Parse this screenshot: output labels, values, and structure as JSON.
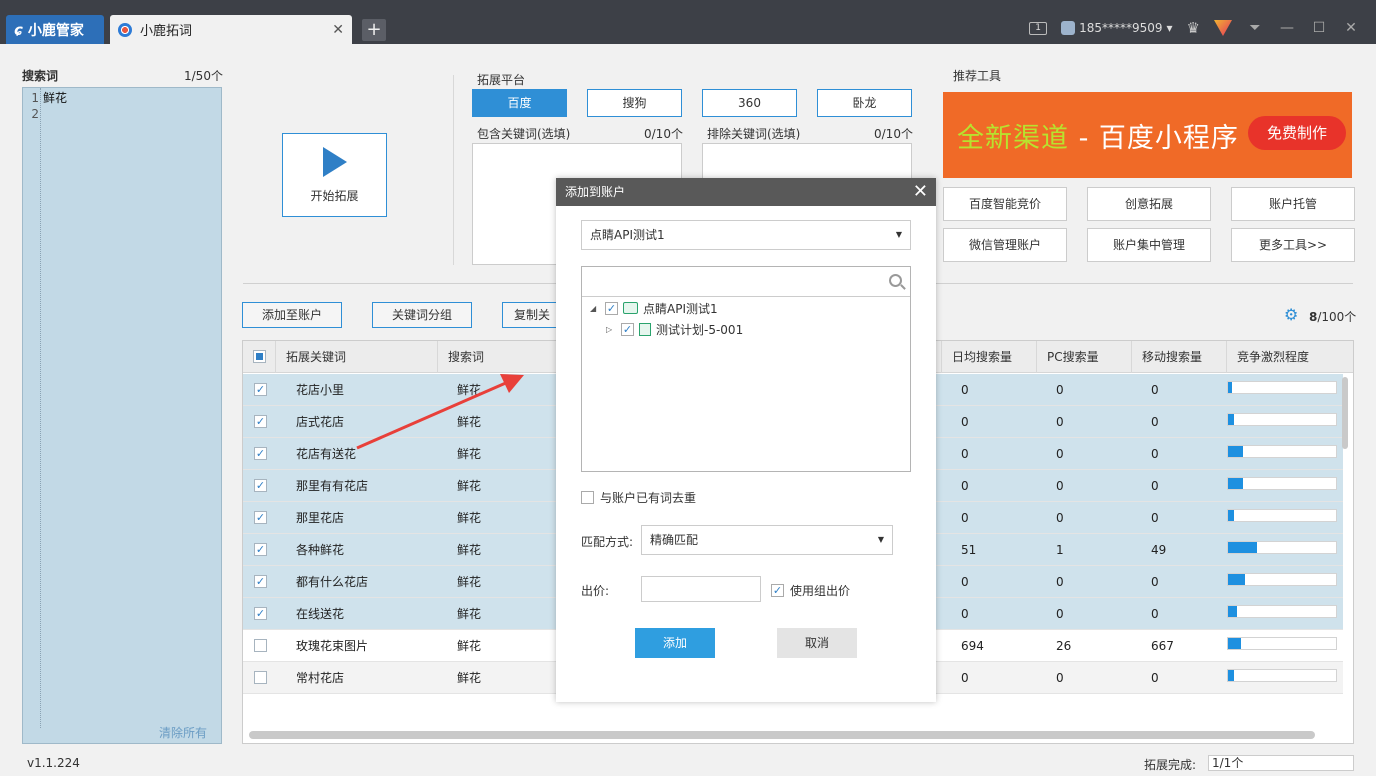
{
  "titlebar": {
    "brand": "小鹿管家",
    "tab_title": "小鹿拓词",
    "tab_close": "✕",
    "new_tab": "+",
    "badge": "1",
    "user": "185*****9509",
    "user_caret": "▾",
    "crown": "♛",
    "minimize": "—",
    "maximize": "☐",
    "close": "✕",
    "menu": "⏷"
  },
  "left": {
    "title": "搜索词",
    "count": "1/50个",
    "lines": [
      {
        "num": "1",
        "text": "鲜花"
      },
      {
        "num": "2",
        "text": ""
      }
    ],
    "clear": "清除所有"
  },
  "start_label": "开始拓展",
  "platform": {
    "title": "拓展平台",
    "buttons": [
      "百度",
      "搜狗",
      "360",
      "卧龙"
    ],
    "active": "百度",
    "include_label": "包含关键词(选填)",
    "include_count": "0/10个",
    "exclude_label": "排除关键词(选填)",
    "exclude_count": "0/10个"
  },
  "tools": {
    "title": "推荐工具",
    "banner_hl": "全新渠道",
    "banner_rest": " - 百度小程序",
    "banner_btn": "免费制作",
    "buttons": [
      "百度智能竞价",
      "创意拓展",
      "账户托管",
      "微信管理账户",
      "账户集中管理",
      "更多工具>>"
    ]
  },
  "actions": {
    "add_to_account": "添加至账户",
    "group": "关键词分组",
    "copy": "复制关"
  },
  "selection": {
    "selected": "8",
    "total": "/100个"
  },
  "table": {
    "headers": [
      "拓展关键词",
      "搜索词",
      "日均搜索量",
      "PC搜索量",
      "移动搜索量",
      "竞争激烈程度"
    ],
    "rows": [
      {
        "kw": "花店小里",
        "src": "鲜花",
        "daily": "0",
        "pc": "0",
        "mobile": "0",
        "comp": 0.04,
        "checked": true
      },
      {
        "kw": "店式花店",
        "src": "鲜花",
        "daily": "0",
        "pc": "0",
        "mobile": "0",
        "comp": 0.06,
        "checked": true
      },
      {
        "kw": "花店有送花",
        "src": "鲜花",
        "daily": "0",
        "pc": "0",
        "mobile": "0",
        "comp": 0.14,
        "checked": true
      },
      {
        "kw": "那里有有花店",
        "src": "鲜花",
        "daily": "0",
        "pc": "0",
        "mobile": "0",
        "comp": 0.14,
        "checked": true
      },
      {
        "kw": "那里花店",
        "src": "鲜花",
        "daily": "0",
        "pc": "0",
        "mobile": "0",
        "comp": 0.06,
        "checked": true
      },
      {
        "kw": "各种鲜花",
        "src": "鲜花",
        "daily": "51",
        "pc": "1",
        "mobile": "49",
        "comp": 0.27,
        "checked": true
      },
      {
        "kw": "都有什么花店",
        "src": "鲜花",
        "daily": "0",
        "pc": "0",
        "mobile": "0",
        "comp": 0.16,
        "checked": true
      },
      {
        "kw": "在线送花",
        "src": "鲜花",
        "daily": "0",
        "pc": "0",
        "mobile": "0",
        "comp": 0.08,
        "checked": true
      },
      {
        "kw": "玫瑰花束图片",
        "src": "鲜花",
        "daily": "694",
        "pc": "26",
        "mobile": "667",
        "comp": 0.12,
        "checked": false
      },
      {
        "kw": "常村花店",
        "src": "鲜花",
        "daily": "0",
        "pc": "0",
        "mobile": "0",
        "comp": 0.06,
        "checked": false
      }
    ]
  },
  "status": {
    "version": "v1.1.224",
    "progress_label": "拓展完成:",
    "progress_value": "1/1个"
  },
  "dialog": {
    "title": "添加到账户",
    "close": "✕",
    "account": "点睛API测试1",
    "tree": {
      "root": "点睛API测试1",
      "child": "测试计划-5-001"
    },
    "dedupe_label": "与账户已有词去重",
    "match_label": "匹配方式:",
    "match_value": "精确匹配",
    "bid_label": "出价:",
    "bid_value": "",
    "group_bid_label": "使用组出价",
    "add": "添加",
    "cancel": "取消"
  },
  "colors": {
    "accent": "#2f8fd6",
    "banner": "#f06a27",
    "selected_row": "#cfe2ec",
    "arrow": "#e8403a"
  }
}
